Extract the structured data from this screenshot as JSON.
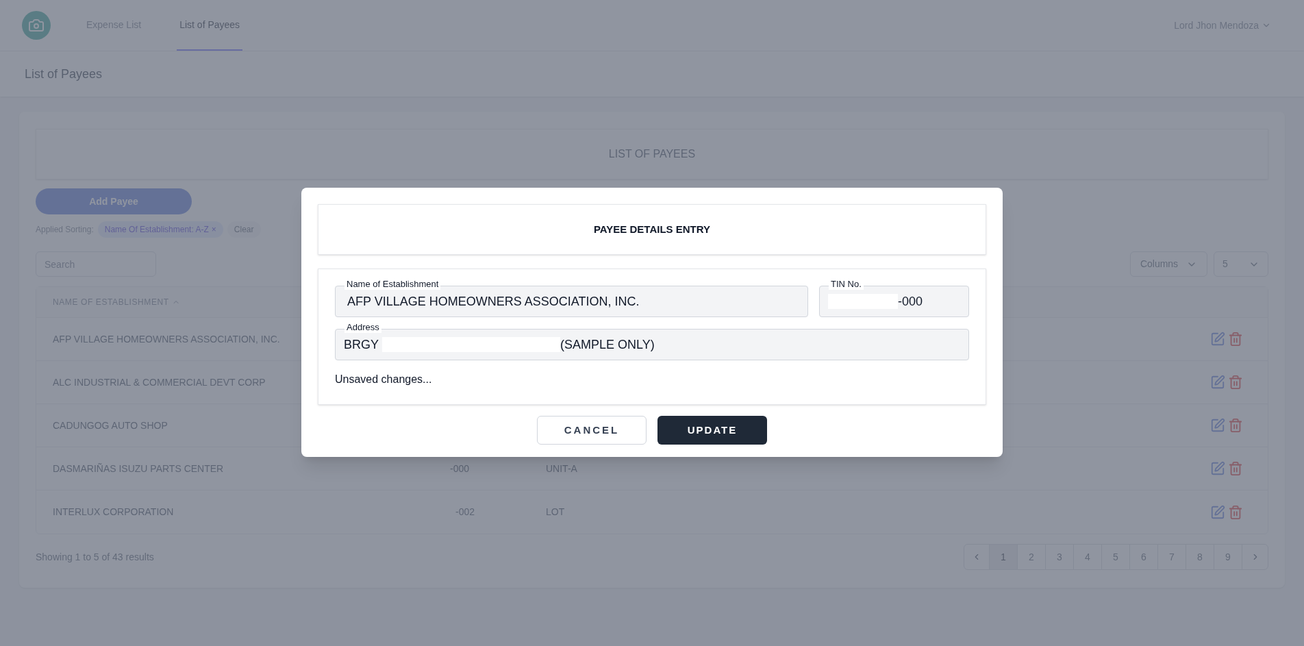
{
  "nav": {
    "links": [
      {
        "label": "Expense List",
        "selected": false
      },
      {
        "label": "List of Payees",
        "selected": true
      }
    ],
    "user": "Lord Jhon Mendoza"
  },
  "page_title": "List of Payees",
  "banner": "LIST OF PAYEES",
  "add_button": "Add Payee",
  "sorting": {
    "label": "Applied Sorting:",
    "chip": "Name Of Establishment: A-Z",
    "chip_remove": "×",
    "clear": "Clear"
  },
  "search": {
    "placeholder": "Search"
  },
  "columns_button": "Columns",
  "page_size": "5",
  "table": {
    "column_1": "NAME OF ESTABLISHMENT",
    "rows": [
      {
        "name": "AFP VILLAGE HOMEOWNERS ASSOCIATION, INC."
      },
      {
        "name": "ALC INDUSTRIAL & COMMERCIAL DEVT CORP"
      },
      {
        "name": "CADUNGOG AUTO SHOP"
      },
      {
        "name": "DASMARIÑAS ISUZU PARTS CENTER",
        "tin": "-000",
        "address": "UNIT-A"
      },
      {
        "name": "INTERLUX CORPORATION",
        "tin": "-002",
        "address": "LOT"
      }
    ]
  },
  "footer": {
    "summary": "Showing 1 to 5 of 43 results",
    "pages": [
      {
        "label": "1",
        "selected": true
      },
      {
        "label": "2",
        "selected": false
      },
      {
        "label": "3",
        "selected": false
      },
      {
        "label": "4",
        "selected": false
      },
      {
        "label": "5",
        "selected": false
      },
      {
        "label": "6",
        "selected": false
      },
      {
        "label": "7",
        "selected": false
      },
      {
        "label": "8",
        "selected": false
      },
      {
        "label": "9",
        "selected": false
      }
    ]
  },
  "modal": {
    "title": "PAYEE DETAILS ENTRY",
    "name_field": {
      "label": "Name of Establishment",
      "value": "AFP VILLAGE HOMEOWNERS ASSOCIATION, INC."
    },
    "tin_field": {
      "label": "TIN No.",
      "value": "-000"
    },
    "address_field": {
      "label": "Address",
      "prefix": "BRGY",
      "suffix": "(SAMPLE ONLY)"
    },
    "status": "Unsaved changes...",
    "cancel": "CANCEL",
    "update": "UPDATE"
  }
}
